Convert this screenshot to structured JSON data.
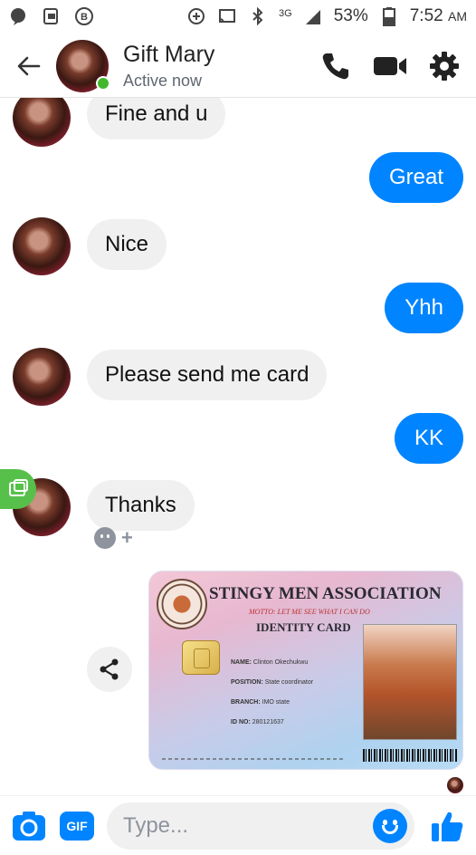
{
  "status_bar": {
    "network": "3G",
    "battery": "53%",
    "time": "7:52",
    "ampm": "AM"
  },
  "header": {
    "contact_name": "Gift Mary",
    "contact_status": "Active now"
  },
  "messages": [
    {
      "direction": "incoming",
      "text": "Fine and u"
    },
    {
      "direction": "outgoing",
      "text": "Great"
    },
    {
      "direction": "incoming",
      "text": "Nice"
    },
    {
      "direction": "outgoing",
      "text": "Yhh"
    },
    {
      "direction": "incoming",
      "text": "Please send me card"
    },
    {
      "direction": "outgoing",
      "text": "KK"
    },
    {
      "direction": "incoming",
      "text": "Thanks"
    }
  ],
  "id_card": {
    "title": "STINGY MEN ASSOCIATION",
    "motto": "MOTTO: LET ME SEE WHAT I CAN DO",
    "card_label": "IDENTITY CARD",
    "name_label": "NAME:",
    "name_value": "Clinton Okechukwu",
    "position_label": "POSITION:",
    "position_value": "State coordinator",
    "branch_label": "BRANCH:",
    "branch_value": "IMO state",
    "id_label": "ID NO:",
    "id_value": "280121637"
  },
  "composer": {
    "gif_label": "GIF",
    "placeholder": "Type..."
  },
  "colors": {
    "accent": "#0084ff",
    "incoming_bubble": "#f1f0f0",
    "online": "#42b72a"
  },
  "icons": {
    "header": [
      "back-arrow-icon",
      "phone-icon",
      "video-icon",
      "gear-icon"
    ],
    "composer": [
      "camera-icon",
      "gif-icon",
      "emoji-icon",
      "thumbs-up-icon"
    ]
  }
}
